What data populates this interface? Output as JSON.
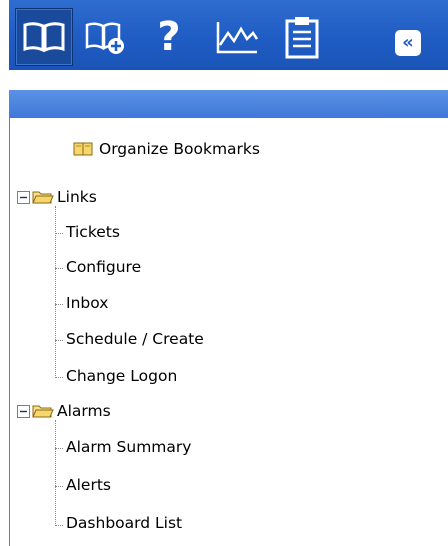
{
  "bookmarks": {
    "organize_label": "Organize Bookmarks"
  },
  "groups": [
    {
      "label": "Links",
      "items": [
        "Tickets",
        "Configure",
        "Inbox",
        "Schedule / Create",
        "Change Logon"
      ]
    },
    {
      "label": "Alarms",
      "items": [
        "Alarm Summary",
        "Alerts",
        "Dashboard List"
      ]
    }
  ],
  "icons": {
    "toolbar": [
      "book-icon",
      "add-bookmark-icon",
      "help-icon",
      "chart-icon",
      "clipboard-icon",
      "collapse-icon"
    ],
    "tree": [
      "collapse-minus-icon",
      "folder-open-icon",
      "bookmark-book-icon"
    ]
  },
  "colors": {
    "toolbar": "#1f5cc3",
    "subbar": "#4a84df",
    "folder": "#f5d76e"
  }
}
